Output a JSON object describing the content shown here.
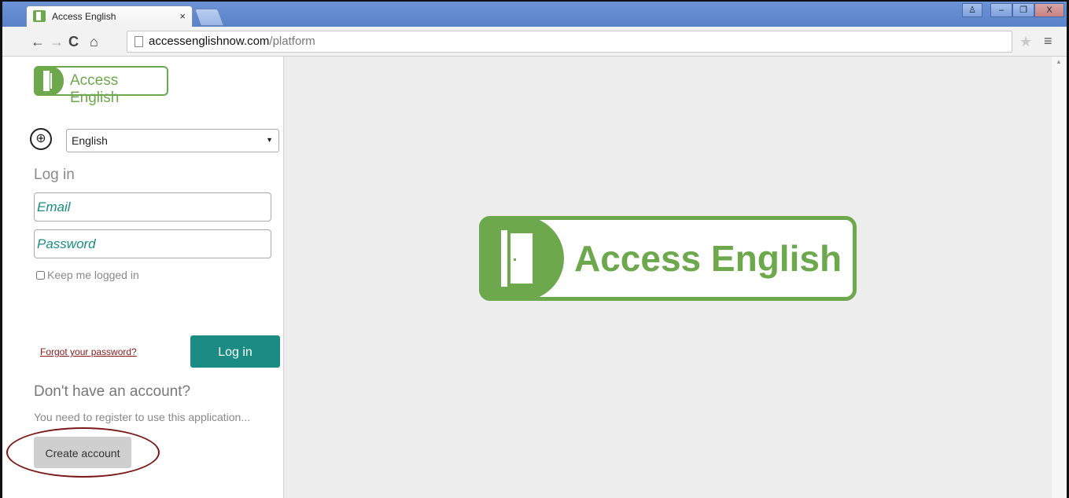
{
  "browser": {
    "tab_title": "Access English",
    "tab_close": "×",
    "url_host": "accessenglishnow.com",
    "url_path": "/platform",
    "window_controls": {
      "user": "♙",
      "minimize": "–",
      "maximize": "❐",
      "close": "X"
    }
  },
  "toolbar_icons": [
    "back-arrow-icon",
    "forward-arrow-icon",
    "reload-icon",
    "home-icon",
    "page-icon",
    "star-icon",
    "menu-icon"
  ],
  "sidebar": {
    "logo_text": "Access English",
    "language": {
      "selected": "English"
    },
    "login_title": "Log in",
    "email_placeholder": "Email",
    "password_placeholder": "Password",
    "keep_logged_in": "Keep me logged in",
    "forgot_password": "Forgot your password?",
    "login_button": "Log in",
    "no_account_title": "Don't have an account?",
    "register_text": "You need to register to use this application...",
    "create_account_button": "Create account"
  },
  "main": {
    "logo_text": "Access English"
  },
  "colors": {
    "brand_green": "#6ea84d",
    "teal": "#1a8c84",
    "highlight": "#7a1a1a"
  }
}
